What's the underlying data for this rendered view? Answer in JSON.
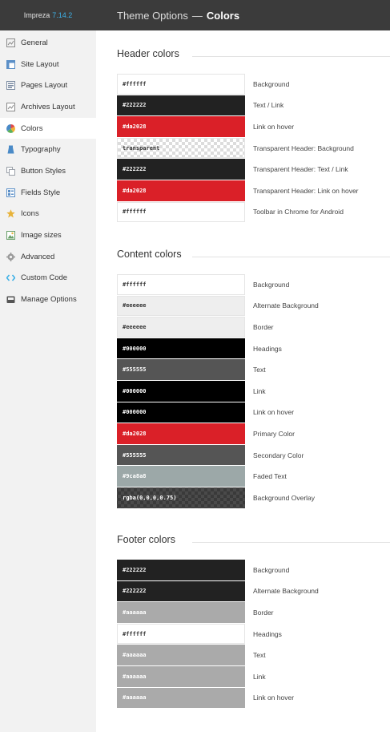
{
  "sidebar": {
    "brand": "Impreza",
    "version": "7.14.2",
    "items": [
      {
        "label": "General",
        "icon": "general-icon",
        "color": "#8a8a8a"
      },
      {
        "label": "Site Layout",
        "icon": "site-layout-icon",
        "color": "#5b8fc7"
      },
      {
        "label": "Pages Layout",
        "icon": "pages-layout-icon",
        "color": "#7a8aa0"
      },
      {
        "label": "Archives Layout",
        "icon": "archives-layout-icon",
        "color": "#8a8a8a"
      },
      {
        "label": "Colors",
        "icon": "colors-icon",
        "color": "#e24a4a",
        "active": true
      },
      {
        "label": "Typography",
        "icon": "typography-icon",
        "color": "#4a8ac7"
      },
      {
        "label": "Button Styles",
        "icon": "button-styles-icon",
        "color": "#9aa0a8"
      },
      {
        "label": "Fields Style",
        "icon": "fields-style-icon",
        "color": "#5b8fc7"
      },
      {
        "label": "Icons",
        "icon": "icons-icon",
        "color": "#e8b33a"
      },
      {
        "label": "Image sizes",
        "icon": "image-sizes-icon",
        "color": "#6aa06a"
      },
      {
        "label": "Advanced",
        "icon": "advanced-icon",
        "color": "#9a9a9a"
      },
      {
        "label": "Custom Code",
        "icon": "custom-code-icon",
        "color": "#3db0e6"
      },
      {
        "label": "Manage Options",
        "icon": "manage-options-icon",
        "color": "#555555"
      }
    ]
  },
  "topbar": {
    "title": "Theme Options",
    "separator": "—",
    "current": "Colors"
  },
  "sections": [
    {
      "title": "Header colors",
      "rows": [
        {
          "value": "#ffffff",
          "label": "Background",
          "swatch": "#ffffff",
          "style": "light"
        },
        {
          "value": "#222222",
          "label": "Text / Link",
          "swatch": "#222222",
          "style": "dark"
        },
        {
          "value": "#da2028",
          "label": "Link on hover",
          "swatch": "#da2028",
          "style": "dark"
        },
        {
          "value": "transparent",
          "label": "Transparent Header: Background",
          "swatch": "transparent",
          "style": "transp"
        },
        {
          "value": "#222222",
          "label": "Transparent Header: Text / Link",
          "swatch": "#222222",
          "style": "dark"
        },
        {
          "value": "#da2028",
          "label": "Transparent Header: Link on hover",
          "swatch": "#da2028",
          "style": "dark"
        },
        {
          "value": "#ffffff",
          "label": "Toolbar in Chrome for Android",
          "swatch": "#ffffff",
          "style": "light"
        }
      ]
    },
    {
      "title": "Content colors",
      "rows": [
        {
          "value": "#ffffff",
          "label": "Background",
          "swatch": "#ffffff",
          "style": "light"
        },
        {
          "value": "#eeeeee",
          "label": "Alternate Background",
          "swatch": "#eeeeee",
          "style": "light"
        },
        {
          "value": "#eeeeee",
          "label": "Border",
          "swatch": "#eeeeee",
          "style": "light"
        },
        {
          "value": "#000000",
          "label": "Headings",
          "swatch": "#000000",
          "style": "dark"
        },
        {
          "value": "#555555",
          "label": "Text",
          "swatch": "#555555",
          "style": "dark"
        },
        {
          "value": "#000000",
          "label": "Link",
          "swatch": "#000000",
          "style": "dark"
        },
        {
          "value": "#000000",
          "label": "Link on hover",
          "swatch": "#000000",
          "style": "dark"
        },
        {
          "value": "#da2028",
          "label": "Primary Color",
          "swatch": "#da2028",
          "style": "dark"
        },
        {
          "value": "#555555",
          "label": "Secondary Color",
          "swatch": "#555555",
          "style": "dark"
        },
        {
          "value": "#9ca8a8",
          "label": "Faded Text",
          "swatch": "#9ca8a8",
          "style": "dark"
        },
        {
          "value": "rgba(0,0,0,0.75)",
          "label": "Background Overlay",
          "swatch": "rgba(0,0,0,0.75)",
          "style": "overlay"
        }
      ]
    },
    {
      "title": "Footer colors",
      "rows": [
        {
          "value": "#222222",
          "label": "Background",
          "swatch": "#222222",
          "style": "dark"
        },
        {
          "value": "#222222",
          "label": "Alternate Background",
          "swatch": "#222222",
          "style": "dark"
        },
        {
          "value": "#aaaaaa",
          "label": "Border",
          "swatch": "#aaaaaa",
          "style": "dark"
        },
        {
          "value": "#ffffff",
          "label": "Headings",
          "swatch": "#ffffff",
          "style": "light"
        },
        {
          "value": "#aaaaaa",
          "label": "Text",
          "swatch": "#aaaaaa",
          "style": "dark"
        },
        {
          "value": "#aaaaaa",
          "label": "Link",
          "swatch": "#aaaaaa",
          "style": "dark"
        },
        {
          "value": "#aaaaaa",
          "label": "Link on hover",
          "swatch": "#aaaaaa",
          "style": "dark"
        }
      ]
    }
  ]
}
